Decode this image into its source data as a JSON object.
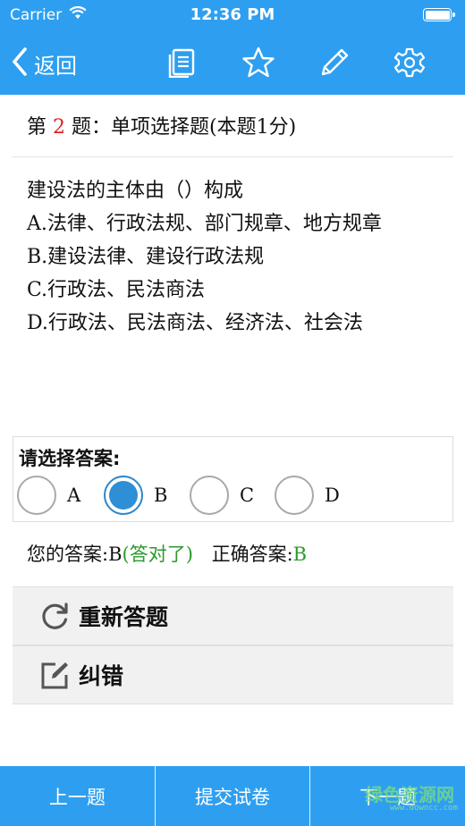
{
  "status_bar": {
    "carrier": "Carrier",
    "time": "12:36 PM",
    "icons": [
      "wifi-icon",
      "battery-icon"
    ]
  },
  "nav": {
    "back_label": "返回",
    "icons": [
      "document-icon",
      "star-icon",
      "pencil-icon",
      "gear-icon"
    ]
  },
  "question": {
    "prefix": "第",
    "number": "2",
    "suffix": "题：单项选择题(本题1分)",
    "stem": "建设法的主体由（）构成",
    "options": [
      "A.法律、行政法规、部门规章、地方规章",
      "B.建设法律、建设行政法规",
      "C.行政法、民法商法",
      "D.行政法、民法商法、经济法、社会法"
    ]
  },
  "answer_select": {
    "title": "请选择答案:",
    "choices": [
      "A",
      "B",
      "C",
      "D"
    ],
    "selected": "B"
  },
  "result": {
    "your_label": "您的答案:",
    "your_answer": "B",
    "verdict": "(答对了)",
    "correct_label": "正确答案:",
    "correct_answer": "B"
  },
  "actions": {
    "retry": "重新答题",
    "report": "纠错"
  },
  "bottom": {
    "prev": "上一题",
    "submit": "提交试卷",
    "next": "下一题"
  },
  "watermark": {
    "text": "绿色资源网",
    "sub": "www.downcc.com"
  },
  "colors": {
    "primary": "#2e9ff0",
    "accent_red": "#e02020",
    "correct_green": "#2a9a2a",
    "radio_selected": "#2e8fd6"
  }
}
